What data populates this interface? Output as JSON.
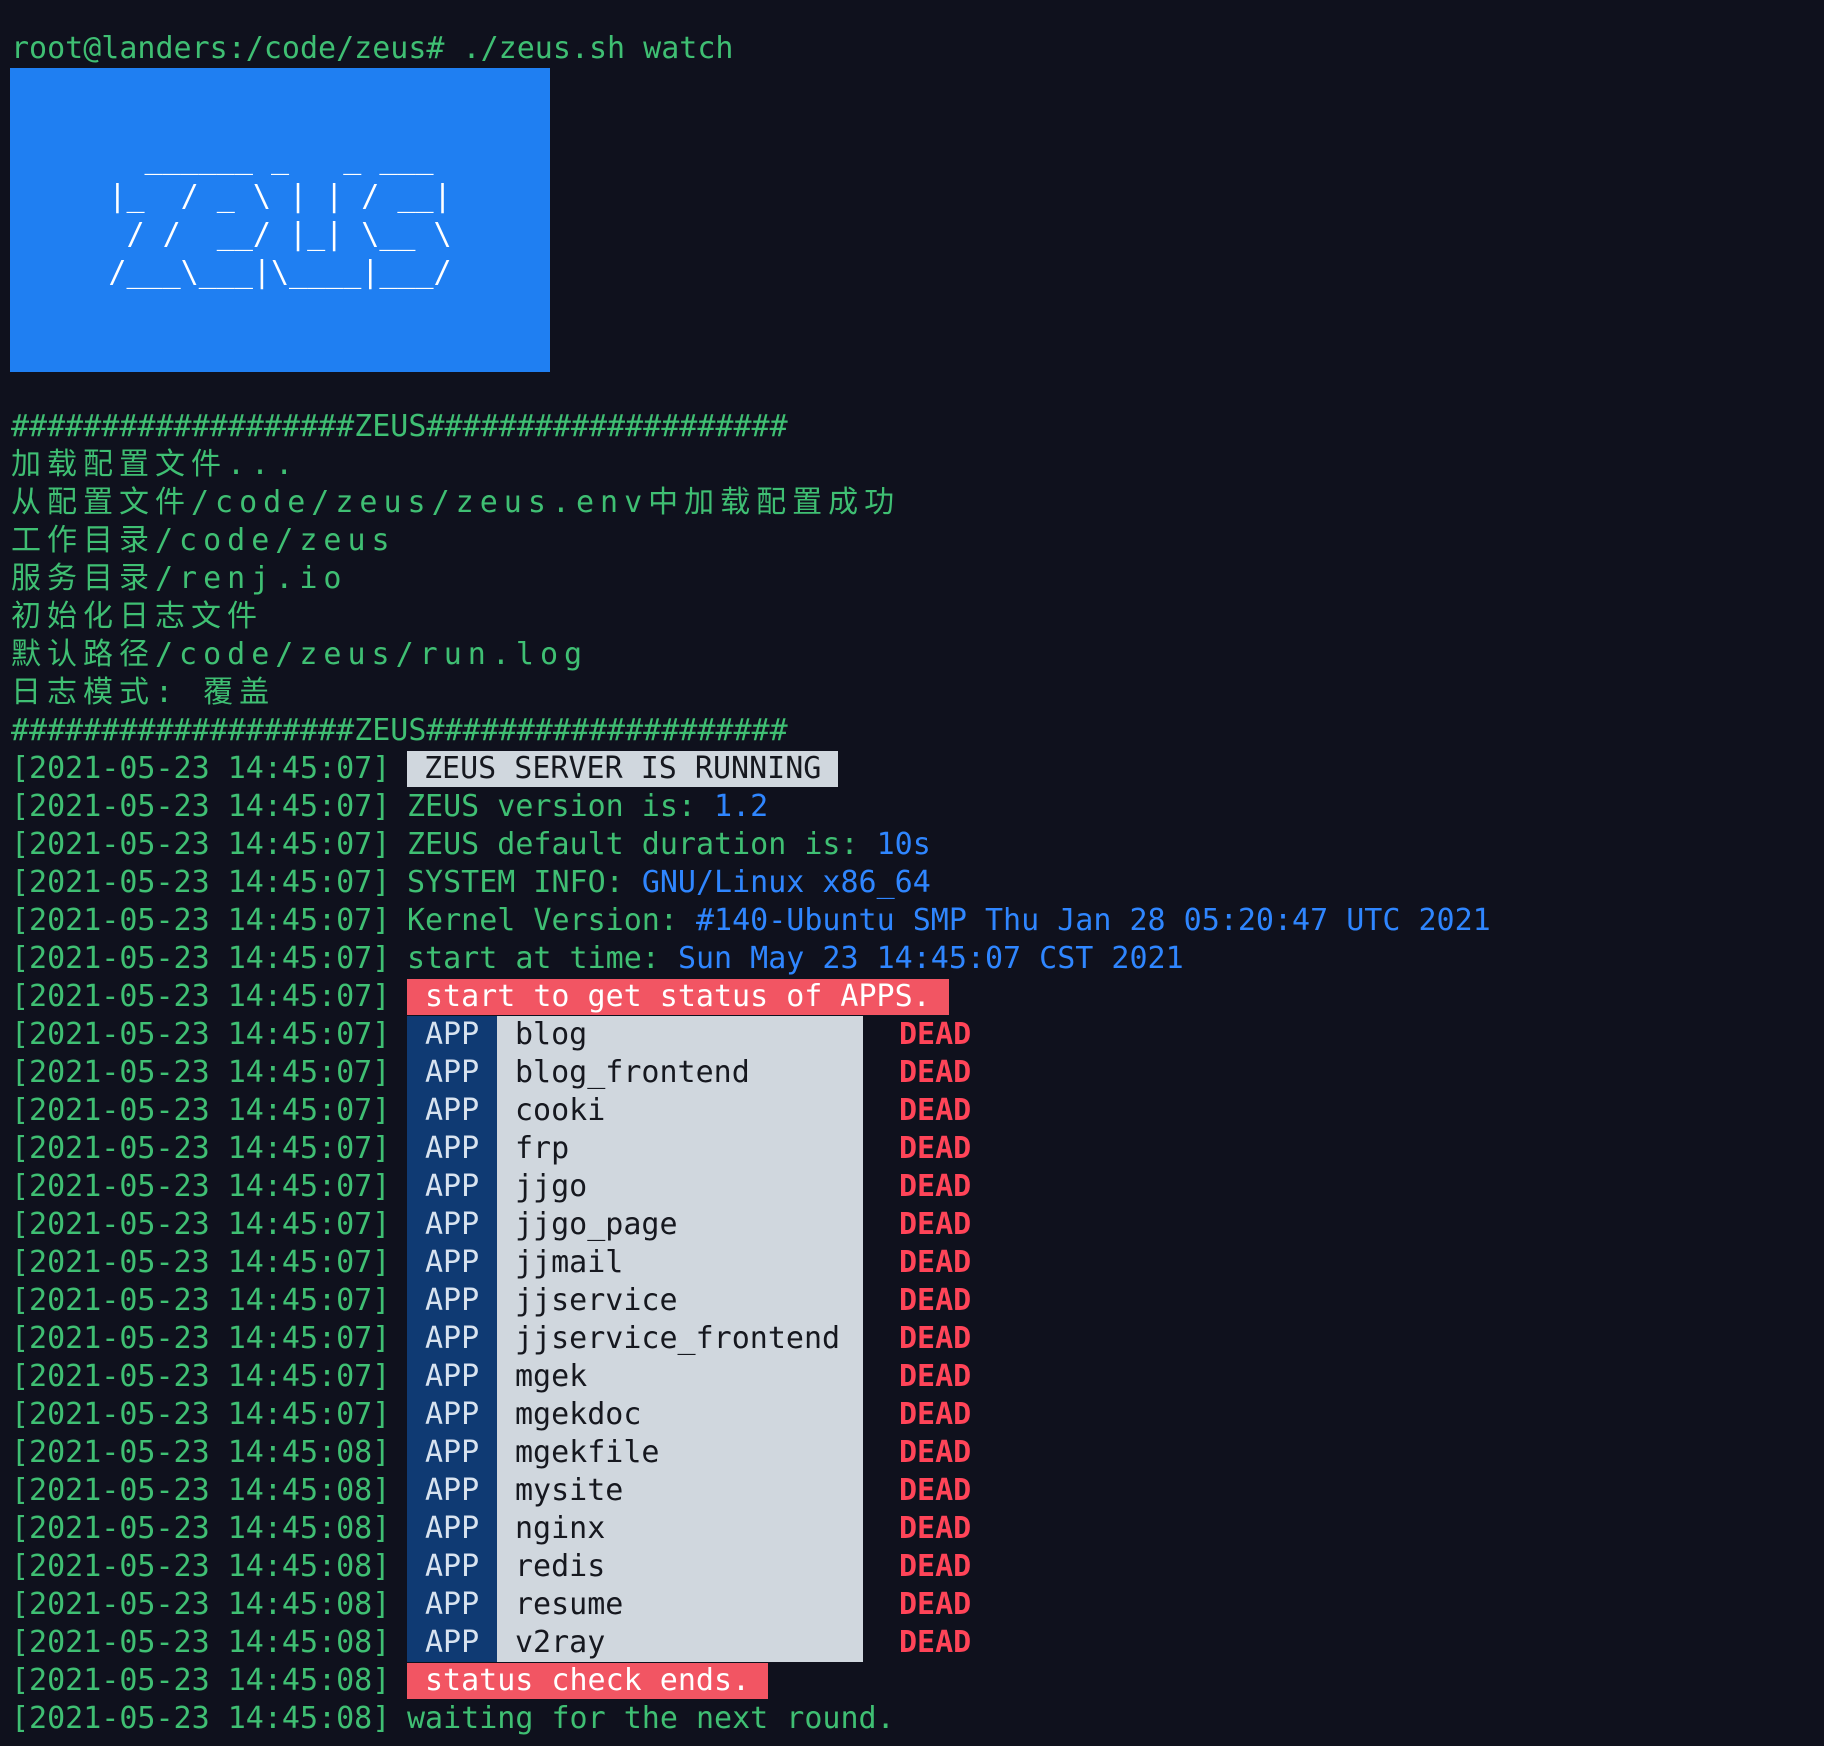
{
  "prompt": {
    "text": "root@landers:/code/zeus# ./zeus.sh watch"
  },
  "logo": {
    "ascii": "  ______ _   _ ___\n|_  / _ \\ | | / __|\n / /  __/ |_| \\__ \\\n/___\\___|\\____|___/",
    "word": "ZEUS"
  },
  "config": {
    "separator": "###################ZEUS####################",
    "lines": [
      "加载配置文件...",
      "从配置文件/code/zeus/zeus.env中加载配置成功",
      "工作目录/code/zeus",
      "服务目录/renj.io",
      "初始化日志文件",
      "默认路径/code/zeus/run.log",
      "日志模式: 覆盖"
    ]
  },
  "log": {
    "running": {
      "ts": "[2021-05-23 14:45:07]",
      "text": "ZEUS SERVER IS RUNNING"
    },
    "version": {
      "ts": "[2021-05-23 14:45:07]",
      "label": "ZEUS version is: ",
      "value": "1.2"
    },
    "duration": {
      "ts": "[2021-05-23 14:45:07]",
      "label": "ZEUS default duration is: ",
      "value": "10s"
    },
    "sysinfo": {
      "ts": "[2021-05-23 14:45:07]",
      "label": "SYSTEM INFO: ",
      "value": "GNU/Linux x86_64"
    },
    "kernel": {
      "ts": "[2021-05-23 14:45:07]",
      "label": "Kernel Version: ",
      "value": "#140-Ubuntu SMP Thu Jan 28 05:20:47 UTC 2021"
    },
    "start": {
      "ts": "[2021-05-23 14:45:07]",
      "label": "start at time: ",
      "value": "Sun May 23 14:45:07 CST 2021"
    },
    "status_begin": {
      "ts": "[2021-05-23 14:45:07]",
      "text": "start to get status of APPS."
    },
    "status_end": {
      "ts": "[2021-05-23 14:45:08]",
      "text": "status check ends."
    },
    "waiting": {
      "ts": "[2021-05-23 14:45:08]",
      "text": "waiting for the next round."
    }
  },
  "apps": [
    {
      "ts": "[2021-05-23 14:45:07]",
      "tag": "APP",
      "name": "blog",
      "status": "DEAD"
    },
    {
      "ts": "[2021-05-23 14:45:07]",
      "tag": "APP",
      "name": "blog_frontend",
      "status": "DEAD"
    },
    {
      "ts": "[2021-05-23 14:45:07]",
      "tag": "APP",
      "name": "cooki",
      "status": "DEAD"
    },
    {
      "ts": "[2021-05-23 14:45:07]",
      "tag": "APP",
      "name": "frp",
      "status": "DEAD"
    },
    {
      "ts": "[2021-05-23 14:45:07]",
      "tag": "APP",
      "name": "jjgo",
      "status": "DEAD"
    },
    {
      "ts": "[2021-05-23 14:45:07]",
      "tag": "APP",
      "name": "jjgo_page",
      "status": "DEAD"
    },
    {
      "ts": "[2021-05-23 14:45:07]",
      "tag": "APP",
      "name": "jjmail",
      "status": "DEAD"
    },
    {
      "ts": "[2021-05-23 14:45:07]",
      "tag": "APP",
      "name": "jjservice",
      "status": "DEAD"
    },
    {
      "ts": "[2021-05-23 14:45:07]",
      "tag": "APP",
      "name": "jjservice_frontend",
      "status": "DEAD"
    },
    {
      "ts": "[2021-05-23 14:45:07]",
      "tag": "APP",
      "name": "mgek",
      "status": "DEAD"
    },
    {
      "ts": "[2021-05-23 14:45:07]",
      "tag": "APP",
      "name": "mgekdoc",
      "status": "DEAD"
    },
    {
      "ts": "[2021-05-23 14:45:08]",
      "tag": "APP",
      "name": "mgekfile",
      "status": "DEAD"
    },
    {
      "ts": "[2021-05-23 14:45:08]",
      "tag": "APP",
      "name": "mysite",
      "status": "DEAD"
    },
    {
      "ts": "[2021-05-23 14:45:08]",
      "tag": "APP",
      "name": "nginx",
      "status": "DEAD"
    },
    {
      "ts": "[2021-05-23 14:45:08]",
      "tag": "APP",
      "name": "redis",
      "status": "DEAD"
    },
    {
      "ts": "[2021-05-23 14:45:08]",
      "tag": "APP",
      "name": "resume",
      "status": "DEAD"
    },
    {
      "ts": "[2021-05-23 14:45:08]",
      "tag": "APP",
      "name": "v2ray",
      "status": "DEAD"
    }
  ],
  "colors": {
    "background": "#0f111d",
    "text_green": "#3fbf73",
    "value_blue": "#2f86ff",
    "logo_blue": "#1f7ff2",
    "status_red": "#ff4458",
    "badge_red": "#f25563",
    "badge_light": "#d0d7de",
    "app_tag_blue": "#0f3a73"
  }
}
